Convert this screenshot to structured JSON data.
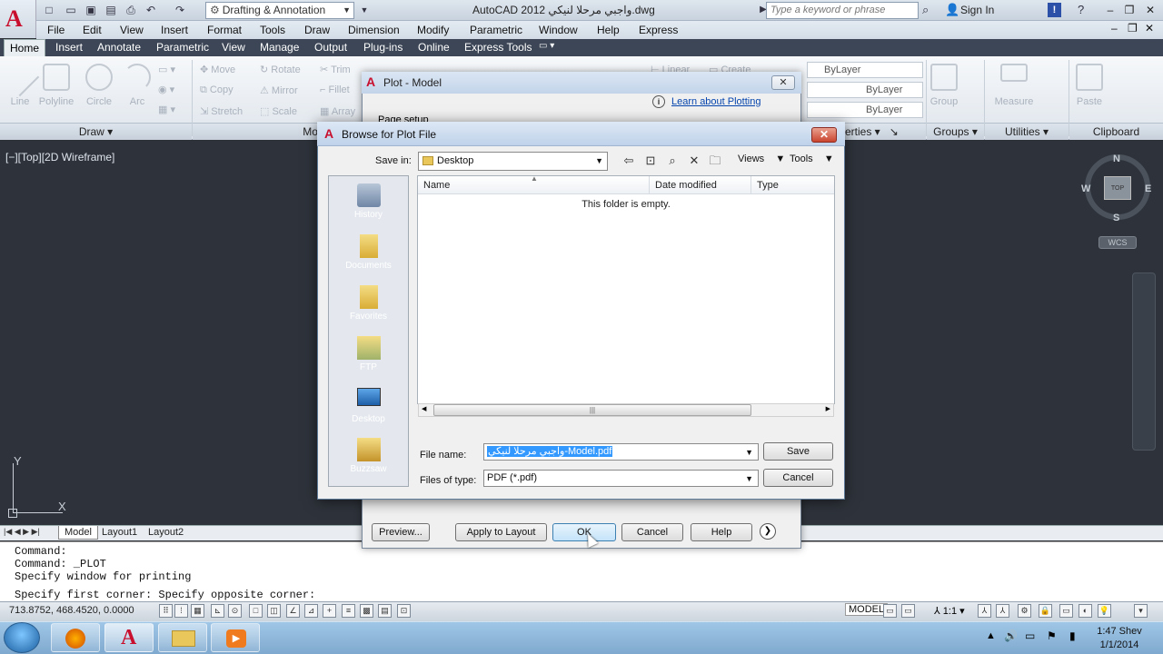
{
  "titlebar": {
    "workspace": "Drafting & Annotation",
    "title": "AutoCAD 2012  واجبي مرحلا لنيكي.dwg",
    "search_placeholder": "Type a keyword or phrase",
    "sign_in": "Sign In"
  },
  "menubar": [
    "File",
    "Edit",
    "View",
    "Insert",
    "Format",
    "Tools",
    "Draw",
    "Dimension",
    "Modify",
    "Parametric",
    "Window",
    "Help",
    "Express"
  ],
  "ribbon_tabs": [
    "Home",
    "Insert",
    "Annotate",
    "Parametric",
    "View",
    "Manage",
    "Output",
    "Plug-ins",
    "Online",
    "Express Tools"
  ],
  "ribbon": {
    "draw_tools": [
      "Line",
      "Polyline",
      "Circle",
      "Arc"
    ],
    "modify_tools": [
      "Move",
      "Rotate",
      "Trim",
      "Copy",
      "Mirror",
      "Fillet",
      "Stretch",
      "Scale",
      "Array"
    ],
    "layer_fragment": "Linear",
    "create_fragment": "Create",
    "props": [
      "ByLayer",
      "ByLayer",
      "ByLayer"
    ],
    "group": "Group",
    "measure": "Measure",
    "paste": "Paste",
    "panels": [
      "Draw",
      "Modify",
      "erties",
      "Groups",
      "Utilities",
      "Clipboard"
    ]
  },
  "viewport": {
    "label": "[−][Top][2D Wireframe]",
    "cube_top": "TOP",
    "compass": {
      "n": "N",
      "s": "S",
      "e": "E",
      "w": "W"
    },
    "wcs": "WCS",
    "ucs_x": "X",
    "ucs_y": "Y"
  },
  "layout_tabs": [
    "Model",
    "Layout1",
    "Layout2"
  ],
  "command_lines": [
    "Command:",
    "Command: _PLOT",
    "Specify window for printing",
    "Specify first corner: Specify opposite corner:"
  ],
  "statusbar": {
    "coords": "713.8752, 468.4520, 0.0000",
    "model": "MODEL",
    "scale": "1:1"
  },
  "taskbar": {
    "time": "1:47 Shev",
    "date": "1/1/2014"
  },
  "plot_dialog": {
    "title": "Plot - Model",
    "learn_link": "Learn about Plotting",
    "page_setup_fragment": "Page setup",
    "buttons": {
      "preview": "Preview...",
      "apply": "Apply to Layout",
      "ok": "OK",
      "cancel": "Cancel",
      "help": "Help"
    }
  },
  "browse_dialog": {
    "title": "Browse for Plot File",
    "save_in_label": "Save in:",
    "save_in_value": "Desktop",
    "views_label": "Views",
    "tools_label": "Tools",
    "places": [
      "History",
      "Documents",
      "Favorites",
      "FTP",
      "Desktop",
      "Buzzsaw"
    ],
    "columns": [
      "Name",
      "Date modified",
      "Type"
    ],
    "empty_text": "This folder is empty.",
    "file_name_label": "File name:",
    "file_name_value": "واجبي مرحلا لنيكي-Model.pdf",
    "file_type_label": "Files of type:",
    "file_type_value": "PDF (*.pdf)",
    "save_button": "Save",
    "cancel_button": "Cancel"
  },
  "colors": {
    "accent": "#c8102e",
    "drawing_bg": "#2e333b",
    "selection": "#3399ff",
    "link": "#0645ad"
  }
}
